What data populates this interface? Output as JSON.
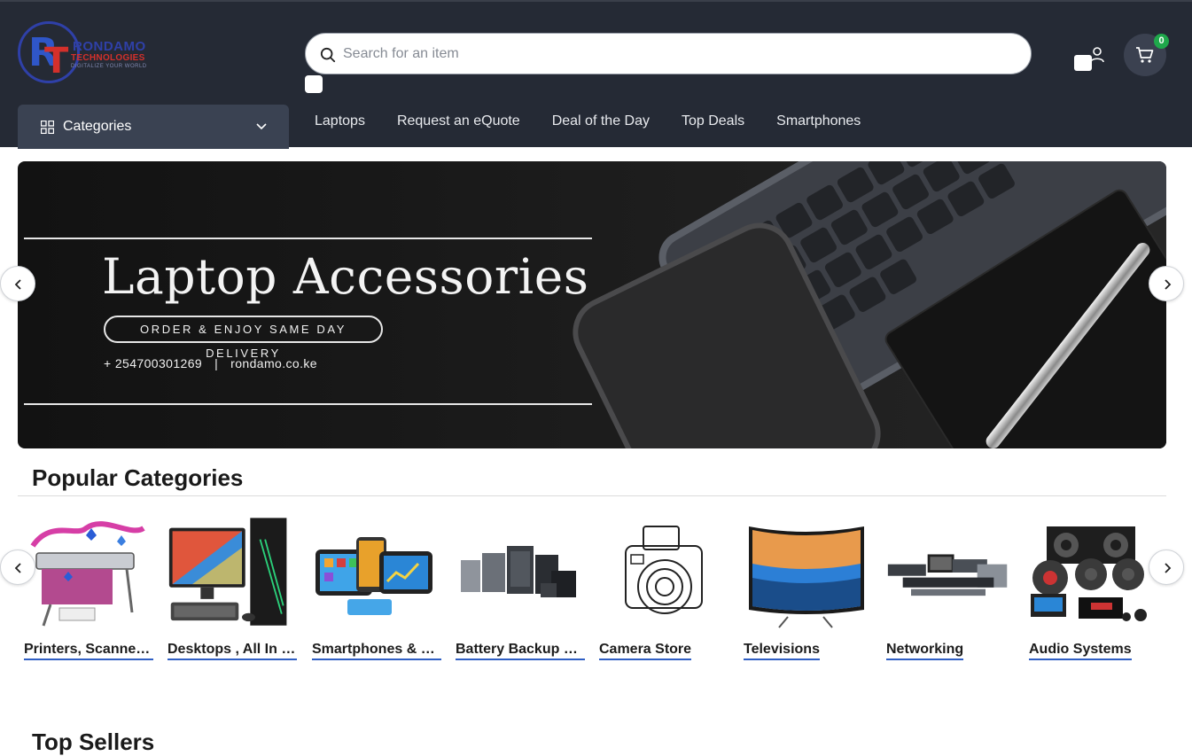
{
  "brand": {
    "name": "RONDAMO",
    "subname": "TECHNOLOGIES",
    "tagline": "DIGITALIZE YOUR WORLD"
  },
  "search": {
    "placeholder": "Search for an item"
  },
  "cart": {
    "count": "0"
  },
  "categories_button": {
    "label": "Categories"
  },
  "nav": [
    "Laptops",
    "Request an eQuote",
    "Deal of the Day",
    "Top Deals",
    "Smartphones"
  ],
  "banner": {
    "title": "Laptop Accessories",
    "pill": "ORDER & ENJOY SAME DAY DELIVERY",
    "phone": "+ 254700301269",
    "separator": "|",
    "website": "rondamo.co.ke"
  },
  "popular": {
    "title": "Popular Categories",
    "items": [
      "Printers, Scanners & Copiers",
      "Desktops , All In One",
      "Smartphones & Tablets",
      "Battery Backup & UPS",
      "Camera Store",
      "Televisions",
      "Networking",
      "Audio Systems"
    ]
  },
  "top_sellers": {
    "title": "Top Sellers"
  },
  "colors": {
    "header_bg": "#252a35",
    "accent_blue": "#2f5fc4",
    "badge_green": "#1fa84b",
    "brand_red": "#d4302b"
  }
}
